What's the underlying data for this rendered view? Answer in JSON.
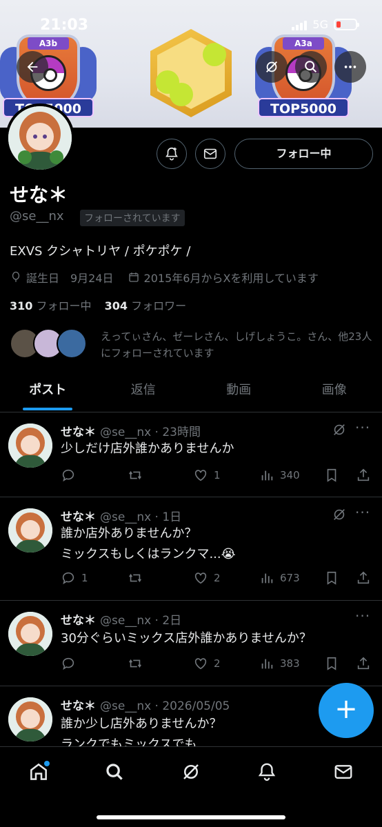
{
  "status_bar": {
    "time": "21:03",
    "network": "5G"
  },
  "banner": {
    "left_badge": {
      "tag": "A3b",
      "ribbon": "TOP5000"
    },
    "right_badge": {
      "tag": "A3a",
      "ribbon": "TOP5000"
    }
  },
  "profile": {
    "name": "せな＊",
    "handle": "@se__nx",
    "follows_you": "フォローされています",
    "follow_button": "フォロー中",
    "bio": "EXVS クシャトリヤ / ポケポケ /",
    "birthday": "誕生日　9月24日",
    "joined": "2015年6月からXを利用しています",
    "following_count": "310",
    "following_label": "フォロー中",
    "followers_count": "304",
    "followers_label": "フォロワー",
    "known_followers": "えってぃさん、ゼーレさん、しげしょうこ。さん、他23人にフォローされています"
  },
  "tabs": [
    {
      "label": "ポスト"
    },
    {
      "label": "返信"
    },
    {
      "label": "動画"
    },
    {
      "label": "画像"
    }
  ],
  "posts": [
    {
      "name": "せな＊",
      "meta": "@se__nx · 23時間",
      "lines": [
        "少しだけ店外誰かありませんか"
      ],
      "replies": "",
      "likes": "1",
      "views": "340"
    },
    {
      "name": "せな＊",
      "meta": "@se__nx · 1日",
      "lines": [
        "誰か店外ありませんか？",
        "ミックスもしくはランクマ...😭"
      ],
      "replies": "1",
      "likes": "2",
      "views": "673"
    },
    {
      "name": "せな＊",
      "meta": "@se__nx · 2日",
      "lines": [
        "30分ぐらいミックス店外誰かありませんか？"
      ],
      "replies": "",
      "likes": "2",
      "views": "383"
    },
    {
      "name": "せな＊",
      "meta": "@se__nx · 2026/05/05",
      "lines": [
        "誰か少し店外ありませんか？",
        "ランクでもミックスでも"
      ]
    }
  ],
  "colors": {
    "accent": "#1d9bf0",
    "background": "#000000",
    "muted": "#71767b",
    "battery_low": "#ff3b30"
  }
}
